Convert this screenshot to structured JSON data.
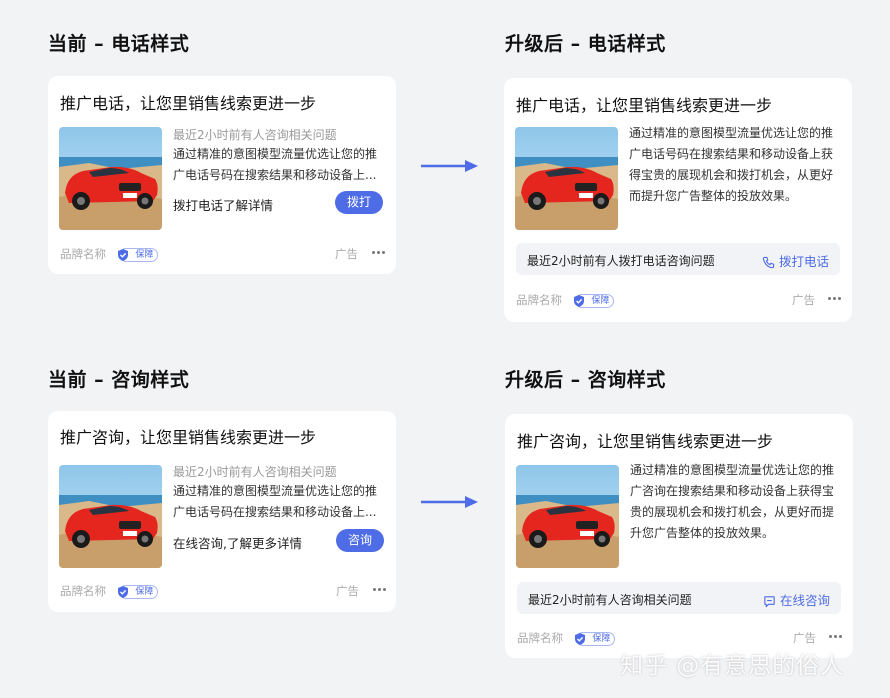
{
  "sections": {
    "phone_before_title": "当前 – 电话样式",
    "phone_after_title": "升级后 – 电话样式",
    "consult_before_title": "当前 – 咨询样式",
    "consult_after_title": "升级后 – 咨询样式"
  },
  "phone_before": {
    "title": "推广电话，让您里销售线索更进一步",
    "sub": "最近2小时前有人咨询相关问题",
    "desc": "通过精准的意图模型流量优选让您的推广电话号码在搜索结果和移动设备上...",
    "cta_text": "拨打电话了解详情",
    "button": "拨打",
    "brand": "品牌名称",
    "badge": "保障",
    "ad": "广告"
  },
  "phone_after": {
    "title": "推广电话，让您里销售线索更进一步",
    "desc": "通过精准的意图模型流量优选让您的推广电话号码在搜索结果和移动设备上获得宝贵的展现机会和拨打机会，从更好而提升您广告整体的投放效果。",
    "bar_text": "最近2小时前有人拨打电话咨询问题",
    "bar_action": "拨打电话",
    "brand": "品牌名称",
    "badge": "保障",
    "ad": "广告"
  },
  "consult_before": {
    "title": "推广咨询，让您里销售线索更进一步",
    "sub": "最近2小时前有人咨询相关问题",
    "desc": "通过精准的意图模型流量优选让您的推广电话号码在搜索结果和移动设备上...",
    "cta_text": "在线咨询,了解更多详情",
    "button": "咨询",
    "brand": "品牌名称",
    "badge": "保障",
    "ad": "广告"
  },
  "consult_after": {
    "title": "推广咨询，让您里销售线索更进一步",
    "desc": "通过精准的意图模型流量优选让您的推广咨询在搜索结果和移动设备上获得宝贵的展现机会和拨打机会，从更好而提升您广告整体的投放效果。",
    "bar_text": "最近2小时前有人咨询相关问题",
    "bar_action": "在线咨询",
    "brand": "品牌名称",
    "badge": "保障",
    "ad": "广告"
  },
  "watermark": "知乎 @有意思的俗人",
  "icons": {
    "thumbnail": "red-car-image",
    "shield": "shield-check-icon",
    "more": "more-dots-icon",
    "phone": "phone-icon",
    "chat": "chat-icon",
    "arrow": "arrow-right-icon"
  },
  "colors": {
    "accent": "#4d6ce6",
    "background": "#f2f3f5",
    "card": "#ffffff"
  }
}
